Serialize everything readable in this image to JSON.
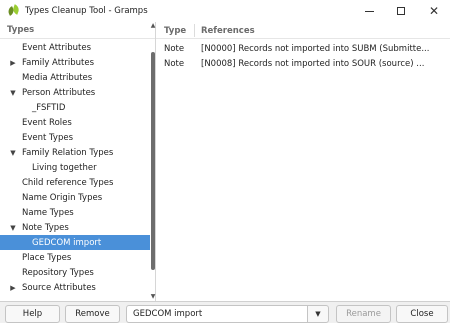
{
  "window": {
    "title": "Types Cleanup Tool - Gramps",
    "min_glyph": "–",
    "max_glyph": "☐",
    "close_glyph": "✕"
  },
  "types_panel": {
    "header": "Types",
    "rows": [
      {
        "label": "Event Attributes",
        "level": 1,
        "expander": "",
        "selected": false
      },
      {
        "label": "Family Attributes",
        "level": 1,
        "expander": "collapsed",
        "selected": false
      },
      {
        "label": "Media Attributes",
        "level": 1,
        "expander": "",
        "selected": false
      },
      {
        "label": "Person Attributes",
        "level": 1,
        "expander": "expanded",
        "selected": false
      },
      {
        "label": "_FSFTID",
        "level": 2,
        "expander": "",
        "selected": false
      },
      {
        "label": "Event Roles",
        "level": 1,
        "expander": "",
        "selected": false
      },
      {
        "label": "Event Types",
        "level": 1,
        "expander": "",
        "selected": false
      },
      {
        "label": "Family Relation Types",
        "level": 1,
        "expander": "expanded",
        "selected": false
      },
      {
        "label": "Living together",
        "level": 2,
        "expander": "",
        "selected": false
      },
      {
        "label": "Child reference Types",
        "level": 1,
        "expander": "",
        "selected": false
      },
      {
        "label": "Name Origin Types",
        "level": 1,
        "expander": "",
        "selected": false
      },
      {
        "label": "Name Types",
        "level": 1,
        "expander": "",
        "selected": false
      },
      {
        "label": "Note Types",
        "level": 1,
        "expander": "expanded",
        "selected": false
      },
      {
        "label": "GEDCOM import",
        "level": 2,
        "expander": "",
        "selected": true
      },
      {
        "label": "Place Types",
        "level": 1,
        "expander": "",
        "selected": false
      },
      {
        "label": "Repository Types",
        "level": 1,
        "expander": "",
        "selected": false
      },
      {
        "label": "Source Attributes",
        "level": 1,
        "expander": "collapsed",
        "selected": false
      }
    ]
  },
  "references_panel": {
    "col_type": "Type",
    "col_references": "References",
    "rows": [
      {
        "type": "Note",
        "reference": "[N0000] Records not imported into SUBM (Submitte..."
      },
      {
        "type": "Note",
        "reference": "[N0008] Records not imported into SOUR (source) ..."
      }
    ]
  },
  "bottom_bar": {
    "help_label": "Help",
    "remove_label": "Remove",
    "combo_value": "GEDCOM import",
    "rename_label": "Rename",
    "close_label": "Close"
  }
}
